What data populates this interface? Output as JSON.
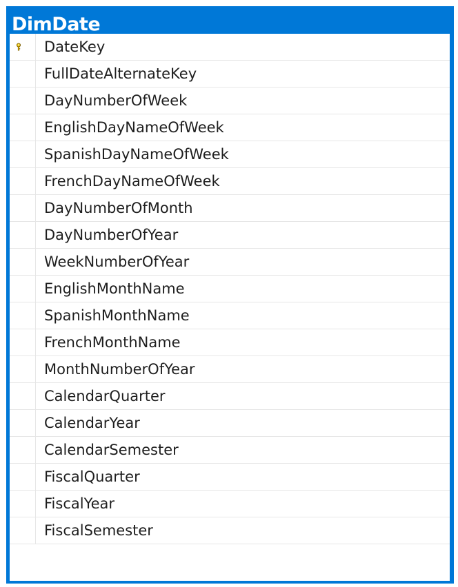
{
  "table": {
    "title": "DimDate",
    "columns": [
      {
        "name": "DateKey",
        "is_primary_key": true
      },
      {
        "name": "FullDateAlternateKey",
        "is_primary_key": false
      },
      {
        "name": "DayNumberOfWeek",
        "is_primary_key": false
      },
      {
        "name": "EnglishDayNameOfWeek",
        "is_primary_key": false
      },
      {
        "name": "SpanishDayNameOfWeek",
        "is_primary_key": false
      },
      {
        "name": "FrenchDayNameOfWeek",
        "is_primary_key": false
      },
      {
        "name": "DayNumberOfMonth",
        "is_primary_key": false
      },
      {
        "name": "DayNumberOfYear",
        "is_primary_key": false
      },
      {
        "name": "WeekNumberOfYear",
        "is_primary_key": false
      },
      {
        "name": "EnglishMonthName",
        "is_primary_key": false
      },
      {
        "name": "SpanishMonthName",
        "is_primary_key": false
      },
      {
        "name": "FrenchMonthName",
        "is_primary_key": false
      },
      {
        "name": "MonthNumberOfYear",
        "is_primary_key": false
      },
      {
        "name": "CalendarQuarter",
        "is_primary_key": false
      },
      {
        "name": "CalendarYear",
        "is_primary_key": false
      },
      {
        "name": "CalendarSemester",
        "is_primary_key": false
      },
      {
        "name": "FiscalQuarter",
        "is_primary_key": false
      },
      {
        "name": "FiscalYear",
        "is_primary_key": false
      },
      {
        "name": "FiscalSemester",
        "is_primary_key": false
      }
    ]
  },
  "colors": {
    "title_bar": "#0078d7",
    "title_text": "#ffffff",
    "grid_background": "#ffffff",
    "grid_lines": "#e6e6e6",
    "column_text": "#1e1e1e",
    "key_icon": "#e8c000"
  },
  "icons": {
    "primary_key": "key-icon"
  }
}
